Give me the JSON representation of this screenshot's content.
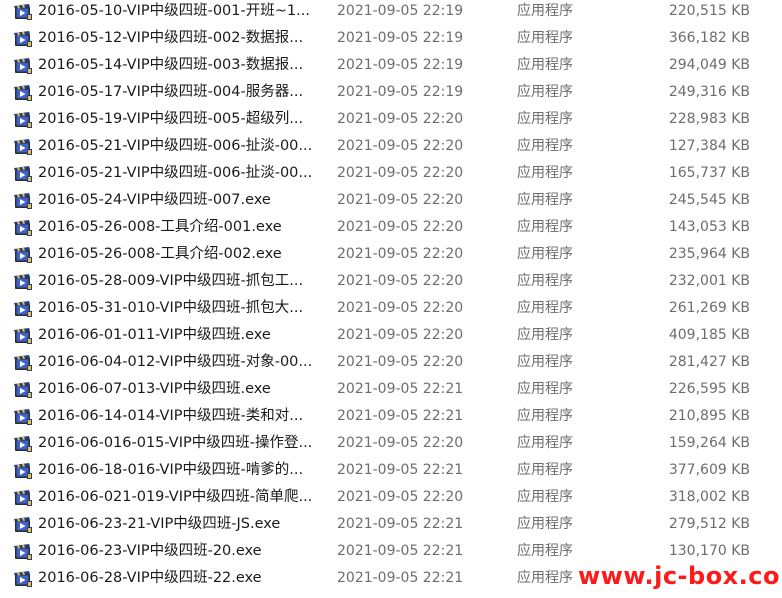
{
  "files": [
    {
      "name": "2016-05-10-VIP中级四班-001-开班~1...",
      "date": "2021-09-05 22:19",
      "type": "应用程序",
      "size": "220,515 KB"
    },
    {
      "name": "2016-05-12-VIP中级四班-002-数据报...",
      "date": "2021-09-05 22:19",
      "type": "应用程序",
      "size": "366,182 KB"
    },
    {
      "name": "2016-05-14-VIP中级四班-003-数据报...",
      "date": "2021-09-05 22:19",
      "type": "应用程序",
      "size": "294,049 KB"
    },
    {
      "name": "2016-05-17-VIP中级四班-004-服务器...",
      "date": "2021-09-05 22:19",
      "type": "应用程序",
      "size": "249,316 KB"
    },
    {
      "name": "2016-05-19-VIP中级四班-005-超级列...",
      "date": "2021-09-05 22:20",
      "type": "应用程序",
      "size": "228,983 KB"
    },
    {
      "name": "2016-05-21-VIP中级四班-006-扯淡-00...",
      "date": "2021-09-05 22:20",
      "type": "应用程序",
      "size": "127,384 KB"
    },
    {
      "name": "2016-05-21-VIP中级四班-006-扯淡-00...",
      "date": "2021-09-05 22:20",
      "type": "应用程序",
      "size": "165,737 KB"
    },
    {
      "name": "2016-05-24-VIP中级四班-007.exe",
      "date": "2021-09-05 22:20",
      "type": "应用程序",
      "size": "245,545 KB"
    },
    {
      "name": "2016-05-26-008-工具介绍-001.exe",
      "date": "2021-09-05 22:20",
      "type": "应用程序",
      "size": "143,053 KB"
    },
    {
      "name": "2016-05-26-008-工具介绍-002.exe",
      "date": "2021-09-05 22:20",
      "type": "应用程序",
      "size": "235,964 KB"
    },
    {
      "name": "2016-05-28-009-VIP中级四班-抓包工...",
      "date": "2021-09-05 22:20",
      "type": "应用程序",
      "size": "232,001 KB"
    },
    {
      "name": "2016-05-31-010-VIP中级四班-抓包大...",
      "date": "2021-09-05 22:20",
      "type": "应用程序",
      "size": "261,269 KB"
    },
    {
      "name": "2016-06-01-011-VIP中级四班.exe",
      "date": "2021-09-05 22:20",
      "type": "应用程序",
      "size": "409,185 KB"
    },
    {
      "name": "2016-06-04-012-VIP中级四班-对象-00...",
      "date": "2021-09-05 22:20",
      "type": "应用程序",
      "size": "281,427 KB"
    },
    {
      "name": "2016-06-07-013-VIP中级四班.exe",
      "date": "2021-09-05 22:21",
      "type": "应用程序",
      "size": "226,595 KB"
    },
    {
      "name": "2016-06-14-014-VIP中级四班-类和对...",
      "date": "2021-09-05 22:21",
      "type": "应用程序",
      "size": "210,895 KB"
    },
    {
      "name": "2016-06-016-015-VIP中级四班-操作登...",
      "date": "2021-09-05 22:20",
      "type": "应用程序",
      "size": "159,264 KB"
    },
    {
      "name": "2016-06-18-016-VIP中级四班-啃爹的...",
      "date": "2021-09-05 22:21",
      "type": "应用程序",
      "size": "377,609 KB"
    },
    {
      "name": "2016-06-021-019-VIP中级四班-简单爬...",
      "date": "2021-09-05 22:20",
      "type": "应用程序",
      "size": "318,002 KB"
    },
    {
      "name": "2016-06-23-21-VIP中级四班-JS.exe",
      "date": "2021-09-05 22:21",
      "type": "应用程序",
      "size": "279,512 KB"
    },
    {
      "name": "2016-06-23-VIP中级四班-20.exe",
      "date": "2021-09-05 22:21",
      "type": "应用程序",
      "size": "130,170 KB"
    },
    {
      "name": "2016-06-28-VIP中级四班-22.exe",
      "date": "2021-09-05 22:21",
      "type": "应用程序",
      "size": ""
    }
  ],
  "watermark": {
    "text": "www.jc-box.com",
    "color": "#ff1a1a"
  },
  "icon": {
    "name": "video-exe-icon",
    "clapper_color": "#1f3c8f",
    "film_color": "#2b2b2b",
    "accent_color": "#f2c230"
  }
}
